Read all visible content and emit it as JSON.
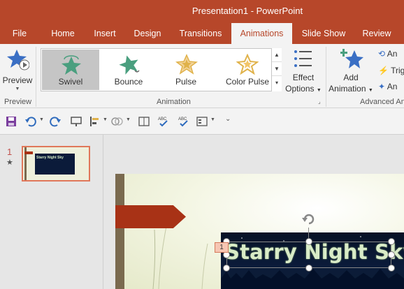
{
  "window": {
    "title": "Presentation1  -  PowerPoint"
  },
  "tabs": [
    "File",
    "Home",
    "Insert",
    "Design",
    "Transitions",
    "Animations",
    "Slide Show",
    "Review"
  ],
  "active_tab": "Animations",
  "ribbon": {
    "preview": {
      "label": "Preview",
      "group": "Preview"
    },
    "animation_group": {
      "label": "Animation",
      "items": [
        "Swivel",
        "Bounce",
        "Pulse",
        "Color Pulse"
      ],
      "selected": "Swivel"
    },
    "effect_options": {
      "line1": "Effect",
      "line2": "Options"
    },
    "add_animation": {
      "line1": "Add",
      "line2": "Animation"
    },
    "advanced_group": {
      "label": "Advanced An",
      "items": [
        "An",
        "Trig",
        "An"
      ]
    }
  },
  "slides_panel": {
    "number": "1",
    "star": "★"
  },
  "slide": {
    "title_text": "Starry Night Sky",
    "thumb_title": "Starry Night Sky",
    "animation_tag": "1"
  },
  "colors": {
    "accent": "#b7472a",
    "selected_item": "#c5c5c5",
    "star_green": "#4a9f7f",
    "star_gold": "#e0b24a",
    "star_blue": "#3a6fc4"
  },
  "icons": [
    "preview-icon",
    "swivel-star-icon",
    "bounce-star-icon",
    "pulse-star-icon",
    "color-pulse-star-icon",
    "effect-options-icon",
    "add-animation-icon",
    "save-icon",
    "undo-icon",
    "redo-icon",
    "rotate-handle-icon"
  ]
}
